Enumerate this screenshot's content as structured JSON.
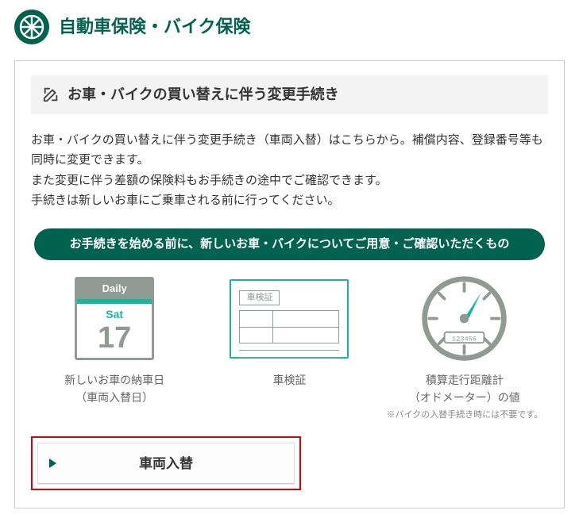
{
  "header": {
    "title": "自動車保険・バイク保険"
  },
  "card": {
    "title": "お車・バイクの買い替えに伴う変更手続き",
    "description_line1": "お車・バイクの買い替えに伴う変更手続き（車両入替）はこちらから。補償内容、登録番号等も同時に変更できます。",
    "description_line2": "また変更に伴う差額の保険料もお手続きの途中でご確認できます。",
    "description_line3": "手続きは新しいお車にご乗車される前に行ってください。",
    "pill": "お手続きを始める前に、新しいお車・バイクについてご用意・ご確認いただくもの"
  },
  "calendar": {
    "top": "Daily",
    "weekday": "Sat",
    "day": "17"
  },
  "document": {
    "title": "車検証"
  },
  "meter": {
    "digits": "123456"
  },
  "prep": [
    {
      "label": "新しいお車の納車日",
      "sub": "（車両入替日）",
      "note": ""
    },
    {
      "label": "車検証",
      "sub": "",
      "note": ""
    },
    {
      "label": "積算走行距離計",
      "sub": "（オドメーター）の値",
      "note": "※バイクの入替手続き時には不要です。"
    }
  ],
  "action": {
    "label": "車両入替"
  }
}
